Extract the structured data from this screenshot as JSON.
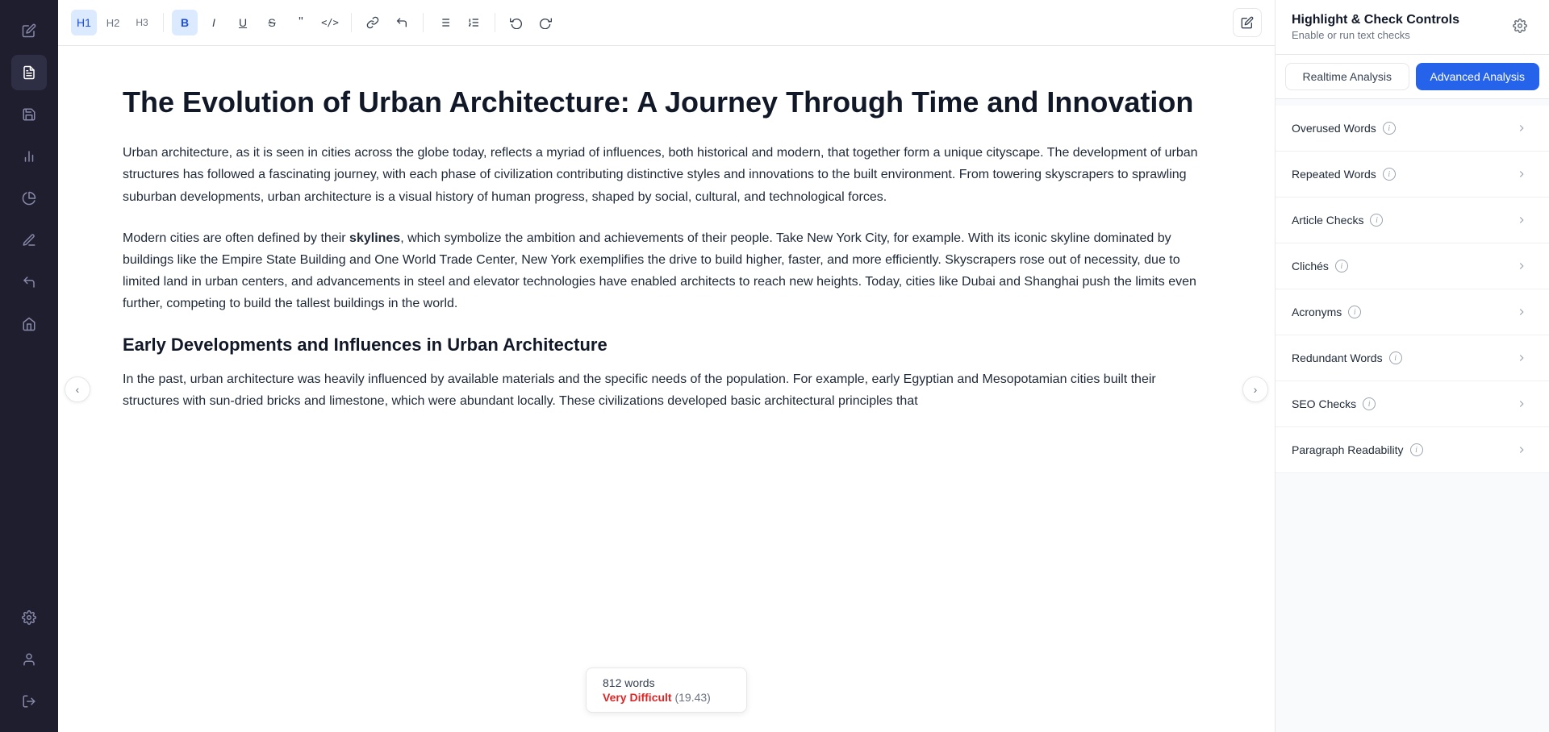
{
  "sidebar": {
    "icons": [
      {
        "name": "edit-icon",
        "symbol": "✏️",
        "active": false
      },
      {
        "name": "document-icon",
        "symbol": "📄",
        "active": true
      },
      {
        "name": "save-icon",
        "symbol": "💾",
        "active": false
      },
      {
        "name": "chart-bar-icon",
        "symbol": "📊",
        "active": false
      },
      {
        "name": "chart-pie-icon",
        "symbol": "🔄",
        "active": false
      },
      {
        "name": "pencil-icon",
        "symbol": "✏",
        "active": false
      },
      {
        "name": "undo-icon",
        "symbol": "↩",
        "active": false
      },
      {
        "name": "home-icon",
        "symbol": "🏠",
        "active": false
      },
      {
        "name": "settings-icon",
        "symbol": "⚙",
        "active": false
      },
      {
        "name": "user-icon",
        "symbol": "👤",
        "active": false
      },
      {
        "name": "logout-icon",
        "symbol": "→",
        "active": false
      }
    ]
  },
  "toolbar": {
    "buttons": [
      {
        "label": "H1",
        "name": "h1-btn",
        "active": true
      },
      {
        "label": "H2",
        "name": "h2-btn",
        "active": false
      },
      {
        "label": "H3",
        "name": "h3-btn",
        "active": false
      },
      {
        "label": "B",
        "name": "bold-btn",
        "active": true,
        "bold": true
      },
      {
        "label": "I",
        "name": "italic-btn",
        "active": false,
        "italic": true
      },
      {
        "label": "U",
        "name": "underline-btn",
        "active": false
      },
      {
        "label": "S",
        "name": "strikethrough-btn",
        "active": false
      },
      {
        "label": "❝❞",
        "name": "quote-btn",
        "active": false
      },
      {
        "label": "</>",
        "name": "code-btn",
        "active": false
      },
      {
        "label": "🔗",
        "name": "link-btn",
        "active": false
      },
      {
        "label": "↩",
        "name": "clear-btn",
        "active": false
      },
      {
        "label": "≡",
        "name": "list-btn",
        "active": false
      },
      {
        "label": "≣",
        "name": "ordered-list-btn",
        "active": false
      },
      {
        "label": "⟲",
        "name": "undo-history-btn",
        "active": false
      },
      {
        "label": "⟳",
        "name": "redo-history-btn",
        "active": false
      }
    ],
    "edit_icon": "✏"
  },
  "editor": {
    "title": "The Evolution of Urban Architecture: A Journey Through Time and Innovation",
    "paragraphs": [
      "Urban architecture, as it is seen in cities across the globe today, reflects a myriad of influences, both historical and modern, that together form a unique cityscape. The development of urban structures has followed a fascinating journey, with each phase of civilization contributing distinctive styles and innovations to the built environment. From towering skyscrapers to sprawling suburban developments, urban architecture is a visual history of human progress, shaped by social, cultural, and technological forces.",
      "Modern cities are often defined by their <strong>skylines</strong>, which symbolize the ambition and achievements of their people. Take New York City, for example. With its iconic skyline dominated by buildings like the Empire State Building and One World Trade Center, New York exemplifies the drive to build higher, faster, and more efficiently. Skyscrapers rose out of necessity, due to limited land in urban centers, and advancements in steel and elevator technologies have enabled architects to reach new heights. Today, cities like Dubai and Shanghai push the limits even further, competing to build the tallest buildings in the world.",
      "In the past, urban architecture was heavily influenced by available materials and the specific needs of the population. For example, early Egyptian and Mesopotamian cities built their structures with sun-dried bricks and limestone, which were abundant locally. These civilizations developed basic architectural principles that"
    ],
    "heading2": "Early Developments and Influences in Urban Architecture",
    "word_count": "812 words",
    "difficulty_label": "Very Difficult",
    "difficulty_score": "(19.43)"
  },
  "panel": {
    "title": "Highlight & Check Controls",
    "subtitle": "Enable or run text checks",
    "tabs": [
      {
        "label": "Realtime Analysis",
        "name": "realtime-tab",
        "active": false
      },
      {
        "label": "Advanced Analysis",
        "name": "advanced-tab",
        "active": true
      }
    ],
    "checks": [
      {
        "label": "Overused Words",
        "name": "overused-words-item"
      },
      {
        "label": "Repeated Words",
        "name": "repeated-words-item"
      },
      {
        "label": "Article Checks",
        "name": "article-checks-item"
      },
      {
        "label": "Clichés",
        "name": "cliches-item"
      },
      {
        "label": "Acronyms",
        "name": "acronyms-item"
      },
      {
        "label": "Redundant Words",
        "name": "redundant-words-item"
      },
      {
        "label": "SEO Checks",
        "name": "seo-checks-item"
      },
      {
        "label": "Paragraph Readability",
        "name": "paragraph-readability-item"
      }
    ]
  },
  "nav": {
    "left_arrow": "‹",
    "right_arrow": "›"
  }
}
